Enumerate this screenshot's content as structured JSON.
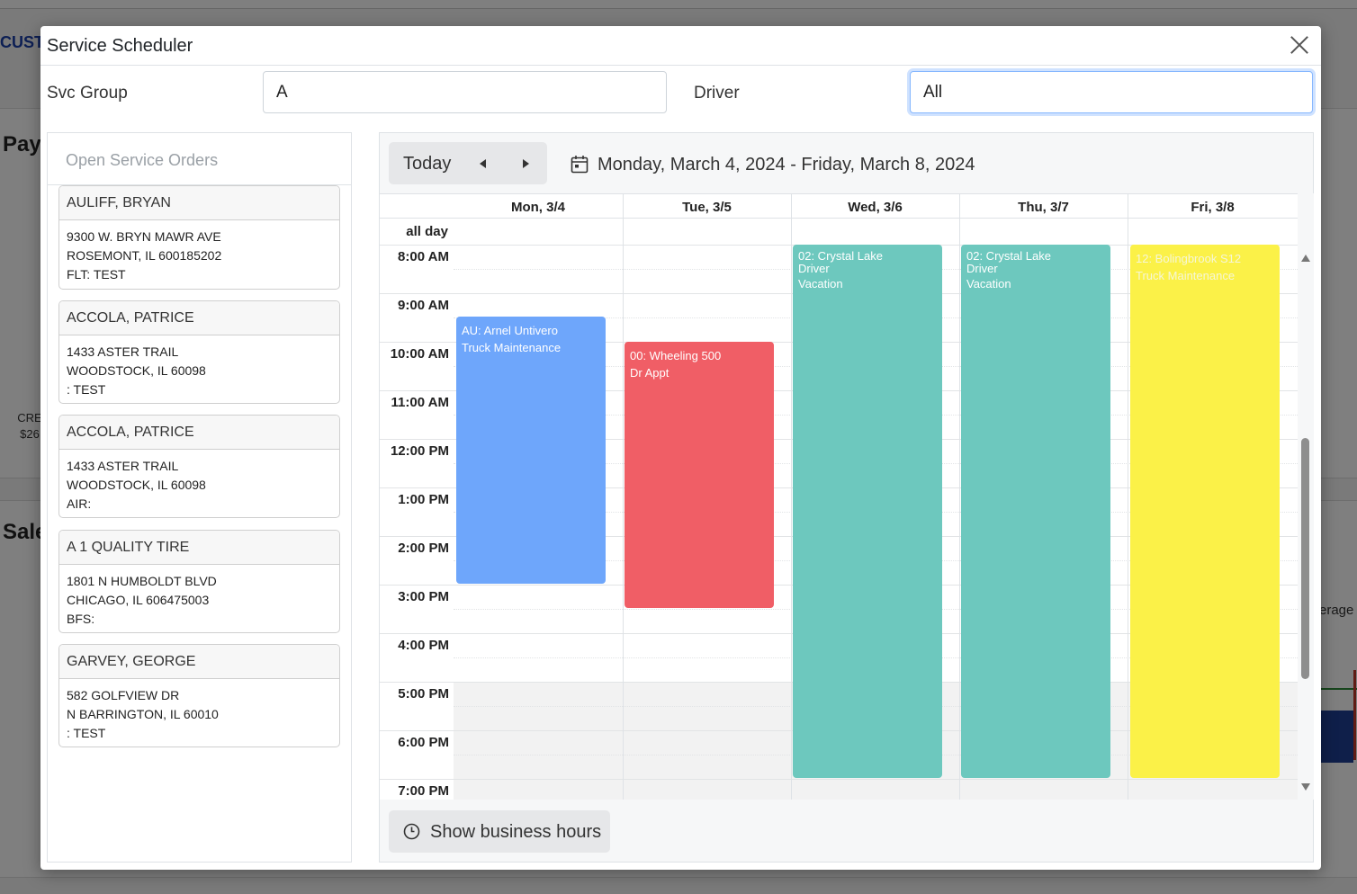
{
  "background": {
    "customer_partial": "CUSTO",
    "pay_partial": "Pay",
    "sales_partial": "Sale",
    "cre_line1": "CRE",
    "cre_line2": "$26",
    "average_partial": "erage"
  },
  "modal": {
    "title": "Service Scheduler",
    "close_icon": "close-icon"
  },
  "filters": {
    "svc_group_label": "Svc Group",
    "svc_group_value": "A",
    "driver_label": "Driver",
    "driver_value": "All"
  },
  "open_orders": {
    "title": "Open Service Orders",
    "items": [
      {
        "name": "AULIFF, BRYAN",
        "line1": "9300 W. BRYN MAWR AVE",
        "line2": "ROSEMONT, IL 600185202",
        "line3": "FLT: TEST"
      },
      {
        "name": "ACCOLA, PATRICE",
        "line1": "1433 ASTER TRAIL",
        "line2": "WOODSTOCK, IL 60098",
        "line3": ": TEST"
      },
      {
        "name": "ACCOLA, PATRICE",
        "line1": "1433 ASTER TRAIL",
        "line2": "WOODSTOCK, IL 60098",
        "line3": "AIR:"
      },
      {
        "name": "A 1 QUALITY TIRE",
        "line1": "1801 N HUMBOLDT BLVD",
        "line2": "CHICAGO, IL 606475003",
        "line3": "BFS:"
      },
      {
        "name": "GARVEY, GEORGE",
        "line1": "582 GOLFVIEW DR",
        "line2": "N BARRINGTON, IL 60010",
        "line3": ": TEST"
      }
    ]
  },
  "calendar": {
    "today_label": "Today",
    "prev_icon": "caret-left-icon",
    "next_icon": "caret-right-icon",
    "date_icon": "calendar-icon",
    "date_range": "Monday, March 4, 2024 - Friday, March 8, 2024",
    "days": [
      "Mon, 3/4",
      "Tue, 3/5",
      "Wed, 3/6",
      "Thu, 3/7",
      "Fri, 3/8"
    ],
    "all_day_label": "all day",
    "hours": [
      "8:00 AM",
      "9:00 AM",
      "10:00 AM",
      "11:00 AM",
      "12:00 PM",
      "1:00 PM",
      "2:00 PM",
      "3:00 PM",
      "4:00 PM",
      "5:00 PM",
      "6:00 PM",
      "7:00 PM"
    ],
    "events": [
      {
        "line1": "AU: Arnel Untivero",
        "line2": "",
        "line3": "Truck Maintenance",
        "color": "#6ea6fb"
      },
      {
        "line1": "00: Wheeling 500",
        "line2": "",
        "line3": "Dr Appt",
        "color": "#f05e66"
      },
      {
        "line1": "02: Crystal Lake",
        "line2": "Driver",
        "line3": "Vacation",
        "color": "#6dc8be"
      },
      {
        "line1": "02: Crystal Lake",
        "line2": "Driver",
        "line3": "Vacation",
        "color": "#6dc8be"
      },
      {
        "line1": "12: Bolingbrook S12",
        "line2": "",
        "line3": "Truck Maintenance",
        "color": "#fbf148"
      }
    ],
    "business_hours_label": "Show business hours",
    "business_hours_icon": "clock-icon"
  }
}
